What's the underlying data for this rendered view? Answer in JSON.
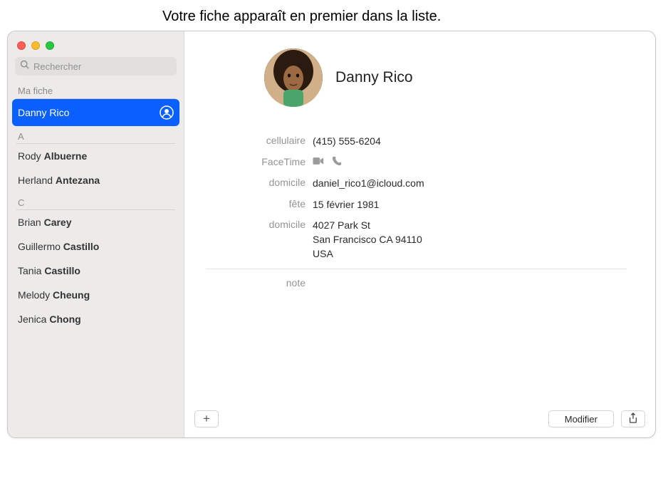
{
  "callout": "Votre fiche apparaît en premier dans la liste.",
  "search": {
    "placeholder": "Rechercher"
  },
  "sidebar": {
    "my_card_label": "Ma fiche",
    "my_card_name": "Danny Rico",
    "sections": [
      {
        "letter": "A",
        "items": [
          {
            "first": "Rody",
            "last": "Albuerne"
          },
          {
            "first": "Herland",
            "last": "Antezana"
          }
        ]
      },
      {
        "letter": "C",
        "items": [
          {
            "first": "Brian",
            "last": "Carey"
          },
          {
            "first": "Guillermo",
            "last": "Castillo"
          },
          {
            "first": "Tania",
            "last": "Castillo"
          },
          {
            "first": "Melody",
            "last": "Cheung"
          },
          {
            "first": "Jenica",
            "last": "Chong"
          }
        ]
      }
    ]
  },
  "detail": {
    "name": "Danny Rico",
    "fields": {
      "mobile_label": "cellulaire",
      "mobile_value": "(415) 555-6204",
      "facetime_label": "FaceTime",
      "home_email_label": "domicile",
      "home_email_value": "daniel_rico1@icloud.com",
      "birthday_label": "fête",
      "birthday_value": "15 février 1981",
      "home_addr_label": "domicile",
      "home_addr_line1": "4027 Park St",
      "home_addr_line2": "San Francisco CA 94110",
      "home_addr_line3": "USA",
      "note_label": "note"
    }
  },
  "buttons": {
    "add": "+",
    "modify": "Modifier"
  }
}
